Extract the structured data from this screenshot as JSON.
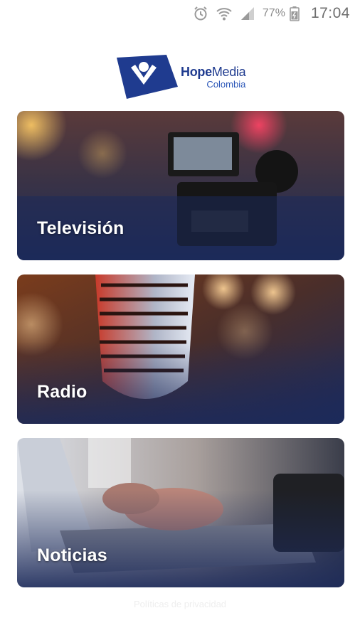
{
  "status_bar": {
    "battery": "77%",
    "time": "17:04",
    "icons": [
      "alarm-icon",
      "wifi-icon",
      "signal-icon",
      "battery-icon"
    ]
  },
  "logo": {
    "brand_bold": "Hope",
    "brand_light": "Media",
    "subtitle": "Colombia",
    "color": "#1f3b8f"
  },
  "cards": [
    {
      "label": "Televisión"
    },
    {
      "label": "Radio"
    },
    {
      "label": "Noticias"
    }
  ],
  "footer": {
    "text": "Políticas de privacidad"
  },
  "colors": {
    "card_overlay": "#1c2a5a",
    "brand": "#1f3b8f"
  }
}
